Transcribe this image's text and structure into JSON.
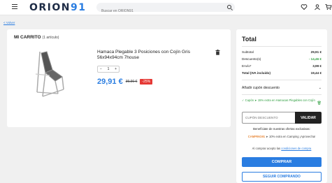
{
  "header": {
    "logo_text": "ORION",
    "logo_number": "91",
    "search_placeholder": "Buscar en ORION91",
    "icons": [
      "menu-icon",
      "search-icon",
      "heart-icon",
      "user-icon",
      "cart-icon"
    ]
  },
  "breadcrumb": {
    "back_label": "< Volver"
  },
  "cart": {
    "title": "MI CARRITO",
    "count_label": "(1 artículo)",
    "item": {
      "name": "Hamaca Plegable 3 Posiciones con Cojín Gris 56x94x94cm 7house",
      "quantity": "1",
      "price_now": "29,91 €",
      "price_old": "39,90 €",
      "discount": "-25%"
    }
  },
  "summary": {
    "title": "Total",
    "rows": [
      {
        "label": "Subtotal",
        "value": "29,91 €"
      },
      {
        "label": "Descuento(s)",
        "value": "- 14,46 €"
      },
      {
        "label": "Envío*",
        "value": "3,99 €"
      }
    ],
    "total_label": "Total (IVA incluido)",
    "total_value": "19,44 €",
    "coupon_toggle_label": "Añadir cupón descuento",
    "coupon_applied_text": "✓ Cupón ➤ 15% extra en Hamacas Plegables con Cojín",
    "coupon_input_placeholder": "CUPÓN DESCUENTO",
    "validate_label": "VALIDAR",
    "benefits_title": "Benefíciate de nuestras ofertas exclusivas:",
    "benefit_brand": "CAMPING91",
    "benefit_text": " ➤ 10% extra en Camping ¡Aprovecha!",
    "terms_text": "Al comprar acepto las",
    "terms_link": "condiciones de compra",
    "buy_label": "COMPRAR",
    "continue_label": "SEGUIR COMPRANDO"
  },
  "colors": {
    "accent": "#2a7de1",
    "discount_red": "#e53935",
    "success_green": "#2e9e3f",
    "benefit_orange": "#e8893a"
  }
}
